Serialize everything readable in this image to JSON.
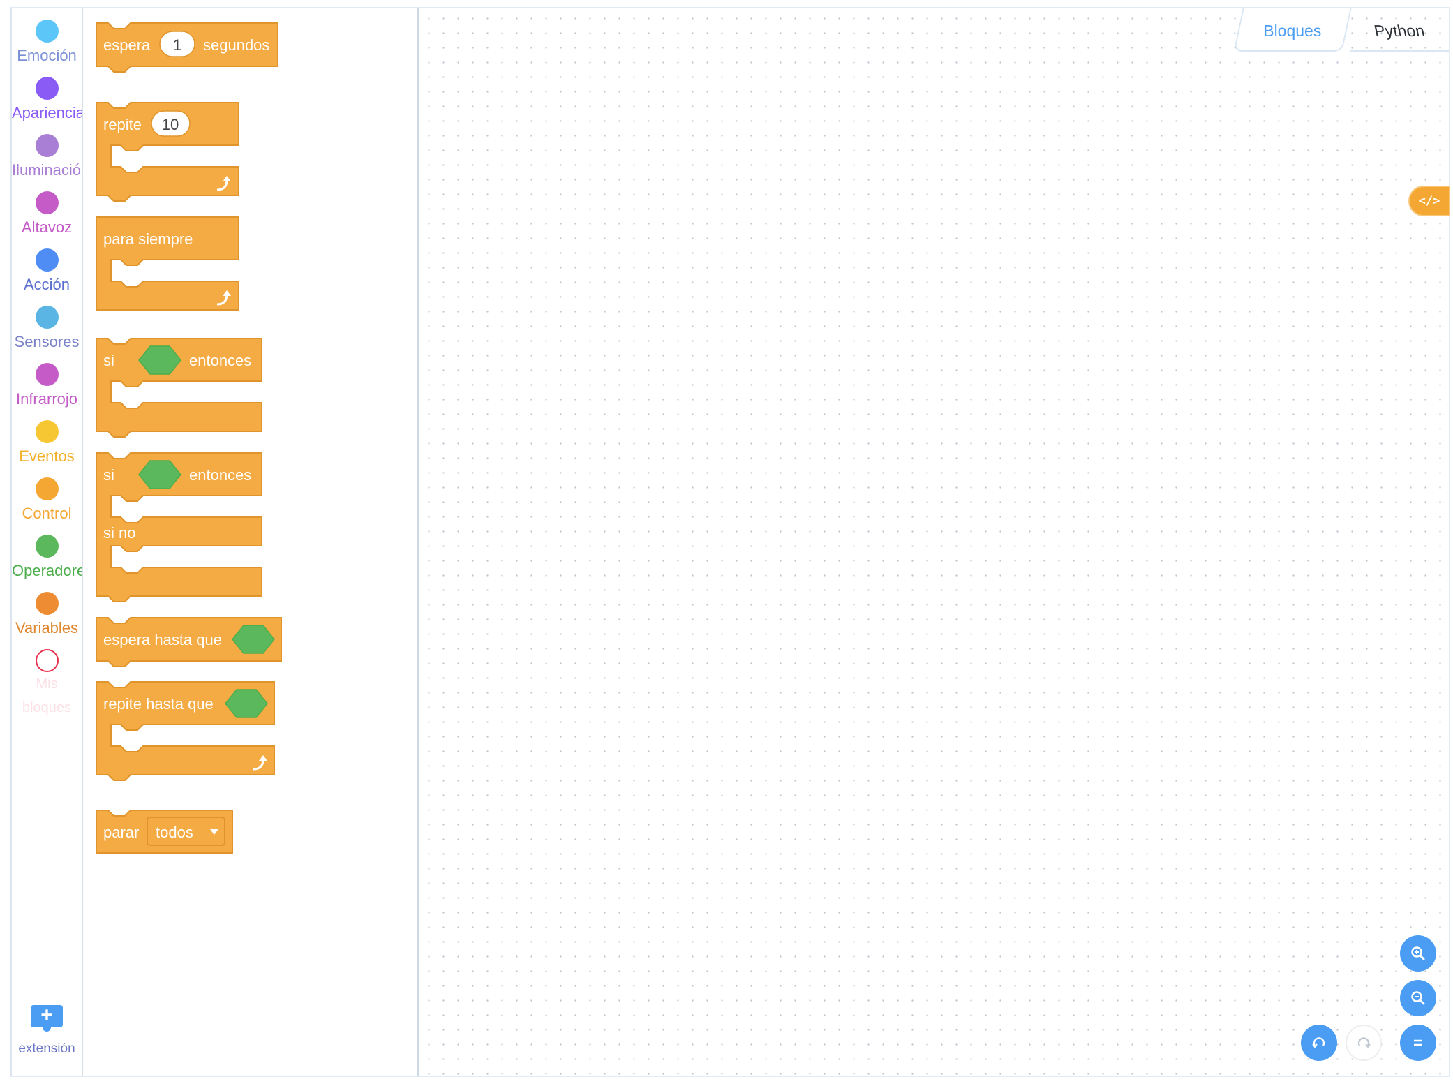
{
  "categories": [
    {
      "label": "Emoción",
      "color": "#5cc6f8",
      "text_color": "#7a8fd6"
    },
    {
      "label": "Apariencia",
      "color": "#8a5cf5",
      "text_color": "#8a5cf5"
    },
    {
      "label": "Iluminación",
      "color": "#a97fd6",
      "text_color": "#a97fd6"
    },
    {
      "label": "Altavoz",
      "color": "#c45bc7",
      "text_color": "#c45bc7"
    },
    {
      "label": "Acción",
      "color": "#4f8df5",
      "text_color": "#5a6fd0"
    },
    {
      "label": "Sensores",
      "color": "#5bb5e4",
      "text_color": "#7a83c9"
    },
    {
      "label": "Infrarrojo",
      "color": "#c45bc7",
      "text_color": "#c45bc7"
    },
    {
      "label": "Eventos",
      "color": "#f7c633",
      "text_color": "#f2b22d"
    },
    {
      "label": "Control",
      "color": "#f4a733",
      "text_color": "#f4a733"
    },
    {
      "label": "Operadores",
      "color": "#5cb85c",
      "text_color": "#4cae4c"
    },
    {
      "label": "Variables",
      "color": "#ee8c33",
      "text_color": "#e0862e"
    },
    {
      "label": "Mis bloques",
      "color": "#e8304f",
      "text_color": "#fbe0e6"
    }
  ],
  "extension": {
    "label": "extensión",
    "icon": "plus-icon"
  },
  "blocks": {
    "wait": {
      "label1": "espera",
      "value": "1",
      "label2": "segundos"
    },
    "repeat": {
      "label": "repite",
      "value": "10"
    },
    "forever": {
      "label": "para siempre"
    },
    "if_then": {
      "label1": "si",
      "label2": "entonces"
    },
    "if_else": {
      "label1": "si",
      "label2": "entonces",
      "label3": "si no"
    },
    "wait_until": {
      "label": "espera hasta que"
    },
    "repeat_until": {
      "label": "repite hasta que"
    },
    "stop": {
      "label": "parar",
      "option": "todos"
    }
  },
  "block_colors": {
    "control": "#f4ab44",
    "control_border": "#e0952c",
    "boolean": "#5cb85c",
    "boolean_border": "#4cae4c"
  },
  "tabs": {
    "blocks": "Bloques",
    "python": "Python"
  },
  "code_toggle": {
    "label": "</>"
  },
  "zoom_controls": [
    "zoom-in-icon",
    "zoom-out-icon",
    "undo-icon",
    "redo-icon",
    "reset-zoom-icon"
  ]
}
